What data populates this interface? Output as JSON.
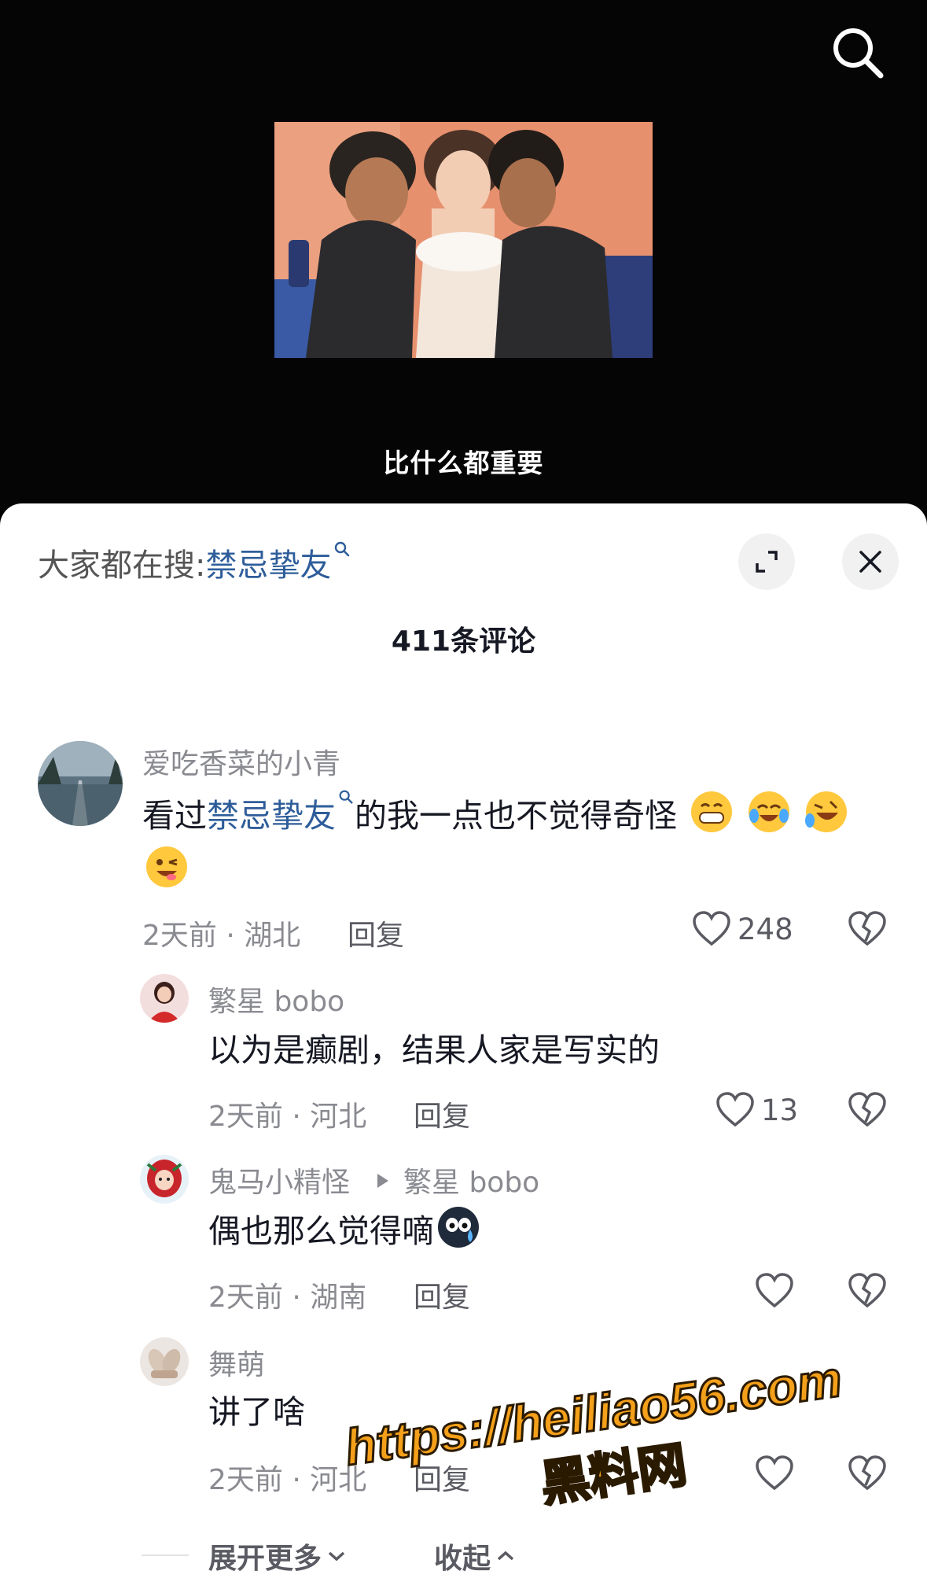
{
  "video": {
    "caption": "比什么都重要"
  },
  "sheet": {
    "hot_search_prefix": "大家都在搜:",
    "hot_search_term": "禁忌挚友",
    "comment_count": "411条评论",
    "expand_more": "展开更多",
    "collapse": "收起"
  },
  "comments": [
    {
      "user": "爱吃香菜的小青",
      "text_pre": "看过",
      "text_link": "禁忌挚友",
      "text_post": "的我一点也不觉得奇怪",
      "time_loc": "2天前 · 湖北",
      "reply": "回复",
      "likes": "248"
    }
  ],
  "replies": [
    {
      "user": "繁星 bobo",
      "text": "以为是癫剧，结果人家是写实的",
      "time_loc": "2天前 · 河北",
      "reply": "回复",
      "likes": "13"
    },
    {
      "user": "鬼马小精怪",
      "reply_to": "繁星 bobo",
      "text": "偶也那么觉得嘀",
      "time_loc": "2天前 · 湖南",
      "reply": "回复",
      "likes": ""
    },
    {
      "user": "舞萌",
      "text": "讲了啥",
      "time_loc": "2天前 · 河北",
      "reply": "回复",
      "likes": ""
    }
  ],
  "watermark": {
    "url": "https://heiliao56.com",
    "name": "黑料网"
  },
  "colors": {
    "link": "#2e5d9a",
    "secondary": "#8a8b91",
    "primary_text": "#161823",
    "watermark_fill": "#f5a01a"
  }
}
